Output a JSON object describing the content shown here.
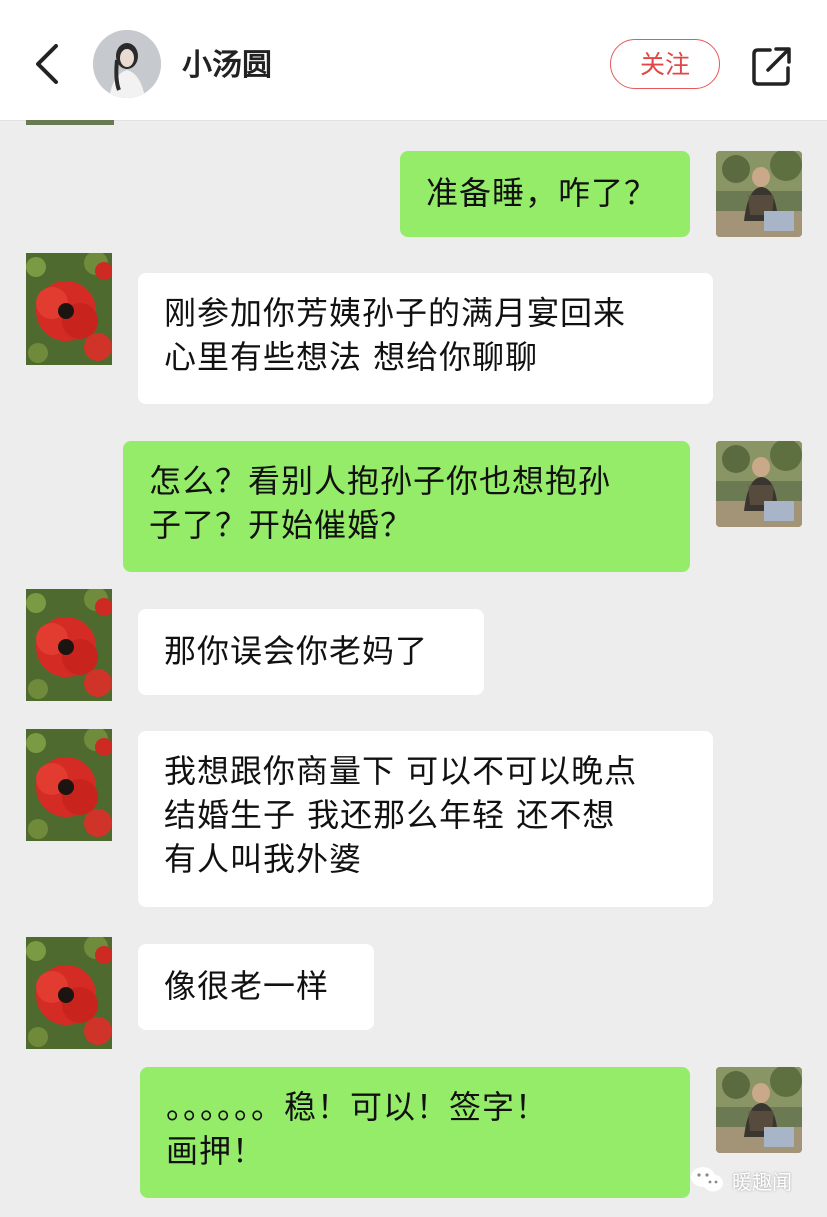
{
  "header": {
    "contact_name": "小汤圆",
    "follow_label": "关注",
    "back_icon": "chevron-left-icon",
    "share_icon": "share-icon"
  },
  "messages": [
    {
      "side": "right",
      "lines": [
        "准备睡，咋了？"
      ]
    },
    {
      "side": "left",
      "lines": [
        "刚参加你芳姨孙子的满月宴回来",
        "心里有些想法 想给你聊聊"
      ]
    },
    {
      "side": "right",
      "lines": [
        "怎么？看别人抱孙子你也想抱孙",
        "子了？开始催婚？"
      ]
    },
    {
      "side": "left",
      "lines": [
        "那你误会你老妈了"
      ]
    },
    {
      "side": "left",
      "lines": [
        "我想跟你商量下 可以不可以晚点",
        "结婚生子 我还那么年轻 还不想",
        "有人叫我外婆"
      ]
    },
    {
      "side": "left",
      "lines": [
        "像很老一样"
      ]
    },
    {
      "side": "right",
      "lines": [
        "。。。。。。稳！可以！签字！",
        "画押！"
      ]
    }
  ],
  "watermark": {
    "text": "暖趣闻",
    "icon": "wechat-icon"
  },
  "colors": {
    "outgoing_bubble": "#95ec69",
    "incoming_bubble": "#ffffff",
    "background": "#ededed",
    "follow_accent": "#e04848"
  }
}
